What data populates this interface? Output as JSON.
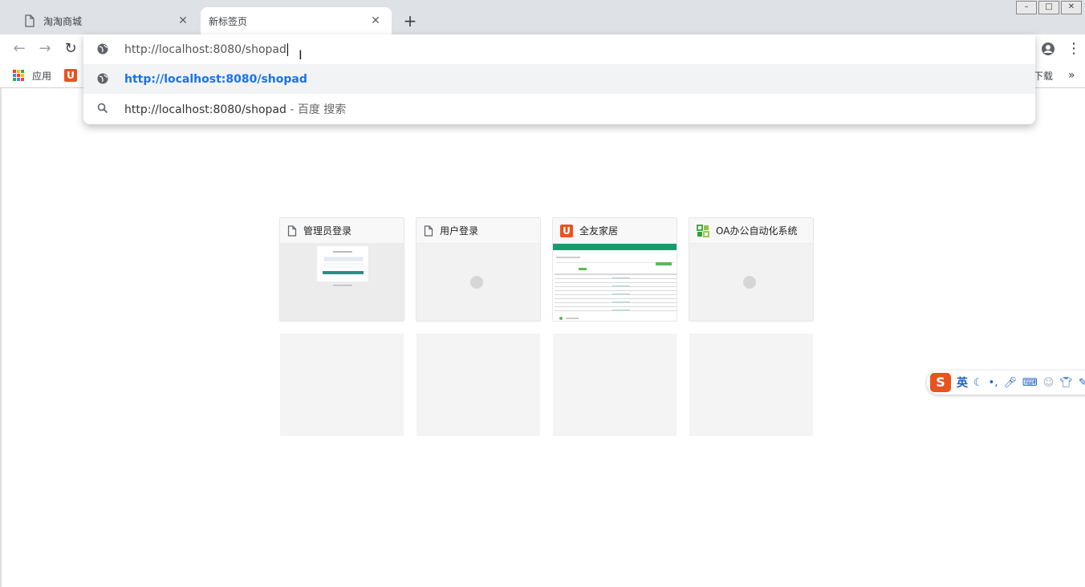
{
  "tabs": [
    {
      "title": "淘淘商城",
      "close": "✕"
    },
    {
      "title": "新标签页",
      "close": "✕"
    }
  ],
  "new_tab_glyph": "+",
  "window_controls": {
    "minimize": "–",
    "maximize": "□",
    "close": "✕"
  },
  "toolbar": {
    "back": "←",
    "forward": "→",
    "reload": "↻",
    "menu": "⋮"
  },
  "omnibox": {
    "input_value": "http://localhost:8080/shopad",
    "suggestion_url": "http://localhost:8080/shopad",
    "search_query": "http://localhost:8080/shopad",
    "search_suffix": " - 百度 搜索"
  },
  "bookmarks": {
    "apps_label": "应用",
    "right_fragment": "下载",
    "overflow": "»"
  },
  "tiles": [
    {
      "label": "管理员登录",
      "icon": "document-icon"
    },
    {
      "label": "用户登录",
      "icon": "document-icon"
    },
    {
      "label": "全友家居",
      "icon": "u-logo-icon"
    },
    {
      "label": "OA办公自动化系统",
      "icon": "oa-grid-icon"
    }
  ],
  "ime": {
    "logo": "S",
    "mode": "英"
  },
  "colors": {
    "accent": "#1a73e8",
    "tabstrip": "#dee1e6",
    "ulogo": "#e8531f"
  }
}
